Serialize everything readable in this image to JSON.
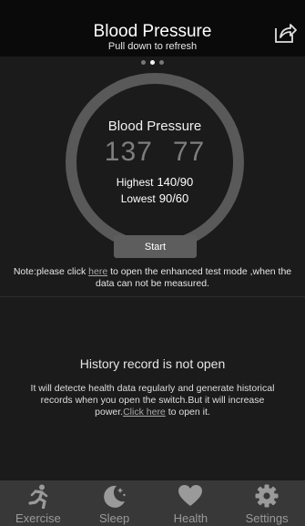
{
  "header": {
    "title": "Blood Pressure",
    "subtitle": "Pull down to refresh",
    "share_icon": "share-icon"
  },
  "pager": {
    "page_count": 3,
    "active_index": 1
  },
  "gauge": {
    "title": "Blood Pressure",
    "systolic": "137",
    "diastolic": "77",
    "highest_label": "Highest",
    "highest_value": "140/90",
    "lowest_label": "Lowest",
    "lowest_value": "90/60",
    "start_label": "Start"
  },
  "note": {
    "prefix": "Note:please click ",
    "link": "here",
    "suffix": " to open the enhanced test mode ,when the data can not be measured."
  },
  "history": {
    "title": "History record is not open",
    "text": "It will detecte health data regularly and generate historical records when you open the switch.But it will increase power.",
    "link": "Click here",
    "suffix": " to open it."
  },
  "nav": {
    "items": [
      {
        "label": "Exercise",
        "icon": "running-icon"
      },
      {
        "label": "Sleep",
        "icon": "moon-icon"
      },
      {
        "label": "Health",
        "icon": "heart-icon"
      },
      {
        "label": "Settings",
        "icon": "gear-icon"
      }
    ]
  },
  "colors": {
    "background": "#1b1b1b",
    "header": "#0a0a0a",
    "ring": "#595959",
    "button": "#5d5d5d",
    "nav": "#383838",
    "nav_icon": "#9a9a9a"
  }
}
